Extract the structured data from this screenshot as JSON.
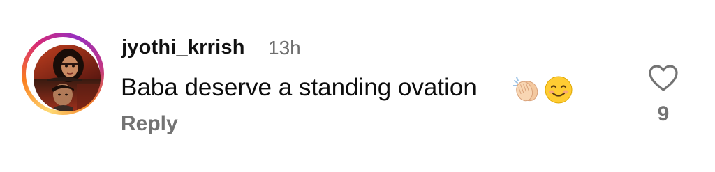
{
  "comment": {
    "username": "jyothi_krrish",
    "timestamp": "13h",
    "text": "Baba deserve a standing ovation",
    "emojis": [
      "clapping-hands",
      "smiling-face"
    ],
    "reply_label": "Reply",
    "like_count": "9",
    "story_ring_colors": [
      "#feda75",
      "#fa7e1e",
      "#d62976",
      "#962fbf"
    ]
  }
}
